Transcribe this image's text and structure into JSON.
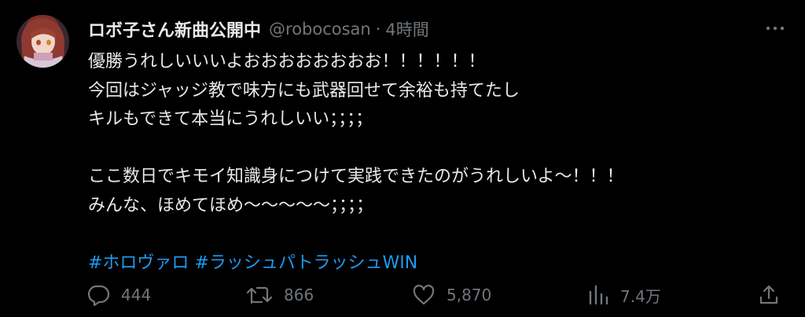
{
  "author": {
    "display_name": "ロボ子さん新曲公開中",
    "handle": "@robocosan",
    "separator": "·",
    "timestamp": "4時間"
  },
  "tweet": {
    "lines": [
      "優勝うれしいいいよおおおおおおおお！！！！！！",
      "今回はジャッジ教で味方にも武器回せて余裕も持てたし",
      "キルもできて本当にうれしいい；；；；",
      "",
      "ここ数日でキモイ知識身につけて実践できたのがうれしいよ〜！！！",
      "みんな、ほめてほめ〜〜〜〜〜；；；；",
      ""
    ],
    "hashtags": [
      "#ホロヴァロ",
      "#ラッシュパトラッシュWIN"
    ]
  },
  "actions": {
    "replies": "444",
    "reposts": "866",
    "likes": "5,870",
    "views": "7.4万"
  },
  "colors": {
    "background": "#000000",
    "text": "#e7e9ea",
    "muted": "#71767b",
    "link": "#1d9bf0"
  },
  "icons": [
    "more-icon",
    "reply-icon",
    "repost-icon",
    "like-icon",
    "views-icon",
    "share-icon"
  ]
}
